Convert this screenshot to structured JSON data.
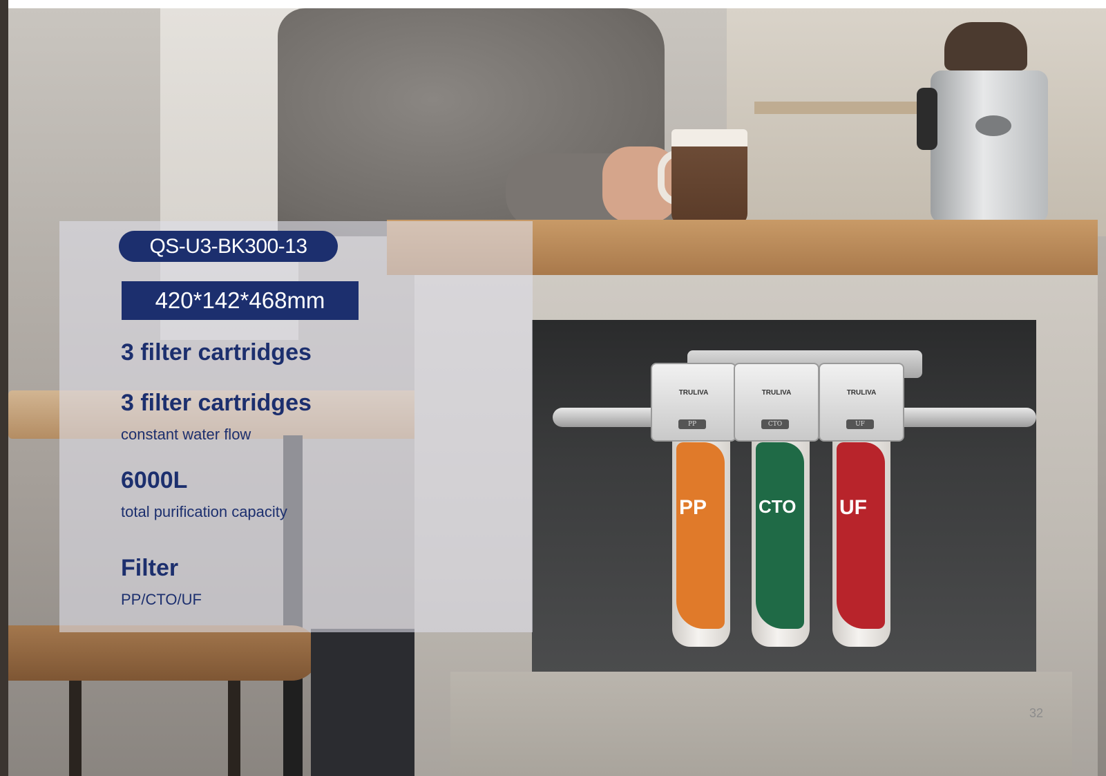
{
  "model": "QS-U3-BK300-13",
  "dimensions": "420*142*468mm",
  "features": [
    {
      "title": "3 filter cartridges",
      "subtitle": ""
    },
    {
      "title": "3 filter cartridges",
      "subtitle": "constant water flow"
    },
    {
      "title": "6000L",
      "subtitle": "total purification capacity"
    },
    {
      "title": "Filter",
      "subtitle": "PP/CTO/UF"
    }
  ],
  "product": {
    "brand": "TRULIVA",
    "heads": [
      "PP",
      "CTO",
      "UF"
    ],
    "cartridges": [
      {
        "label": "PP",
        "color": "#e07a2a"
      },
      {
        "label": "CTO",
        "color": "#1f6a46"
      },
      {
        "label": "UF",
        "color": "#b8242b"
      }
    ]
  },
  "page_number": "32",
  "colors": {
    "accent": "#1c2f6e"
  }
}
